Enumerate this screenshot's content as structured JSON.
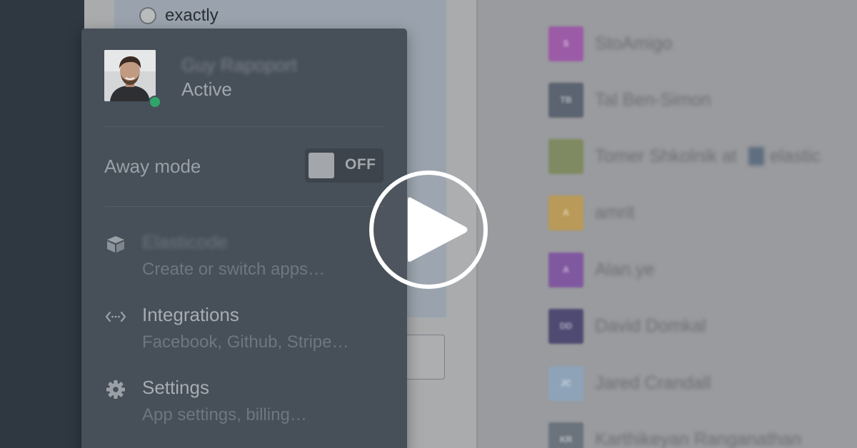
{
  "background": {
    "radio_option": "exactly",
    "contacts": [
      {
        "name": "StoAmigo",
        "avatar_color": "#9b5ba6",
        "initials": "S"
      },
      {
        "name": "Tal Ben-Simon",
        "avatar_color": "#5b6470",
        "initials": "TB"
      },
      {
        "name": "Tomer Shkolnik at",
        "extra": "elastic",
        "avatar_color": "#7f8a62",
        "initials": ""
      },
      {
        "name": "amrit",
        "avatar_color": "#b99a58",
        "initials": "A"
      },
      {
        "name": "Alan.ye",
        "avatar_color": "#8058a0",
        "initials": "A"
      },
      {
        "name": "David Domkal",
        "avatar_color": "#4e4a72",
        "initials": "DD"
      },
      {
        "name": "Jared Crandall",
        "avatar_color": "#8ea3b8",
        "initials": "JC"
      },
      {
        "name": "Karthikeyan Ranganathan",
        "avatar_color": "#6b737c",
        "initials": "KR"
      }
    ]
  },
  "popover": {
    "user": {
      "name": "Guy Rapoport",
      "status": "Active"
    },
    "away_mode": {
      "label": "Away mode",
      "state": "OFF"
    },
    "menu": [
      {
        "title": "Elasticode",
        "subtitle": "Create or switch apps…",
        "icon": "box-icon",
        "blurred": true
      },
      {
        "title": "Integrations",
        "subtitle": "Facebook, Github, Stripe…",
        "icon": "code-arrows-icon",
        "blurred": false
      },
      {
        "title": "Settings",
        "subtitle": "App settings, billing…",
        "icon": "gear-icon",
        "blurred": false
      }
    ]
  },
  "overlay": {
    "icon": "play-icon"
  },
  "colors": {
    "presence": "#2fa56a",
    "popover_bg": "#474f58"
  }
}
